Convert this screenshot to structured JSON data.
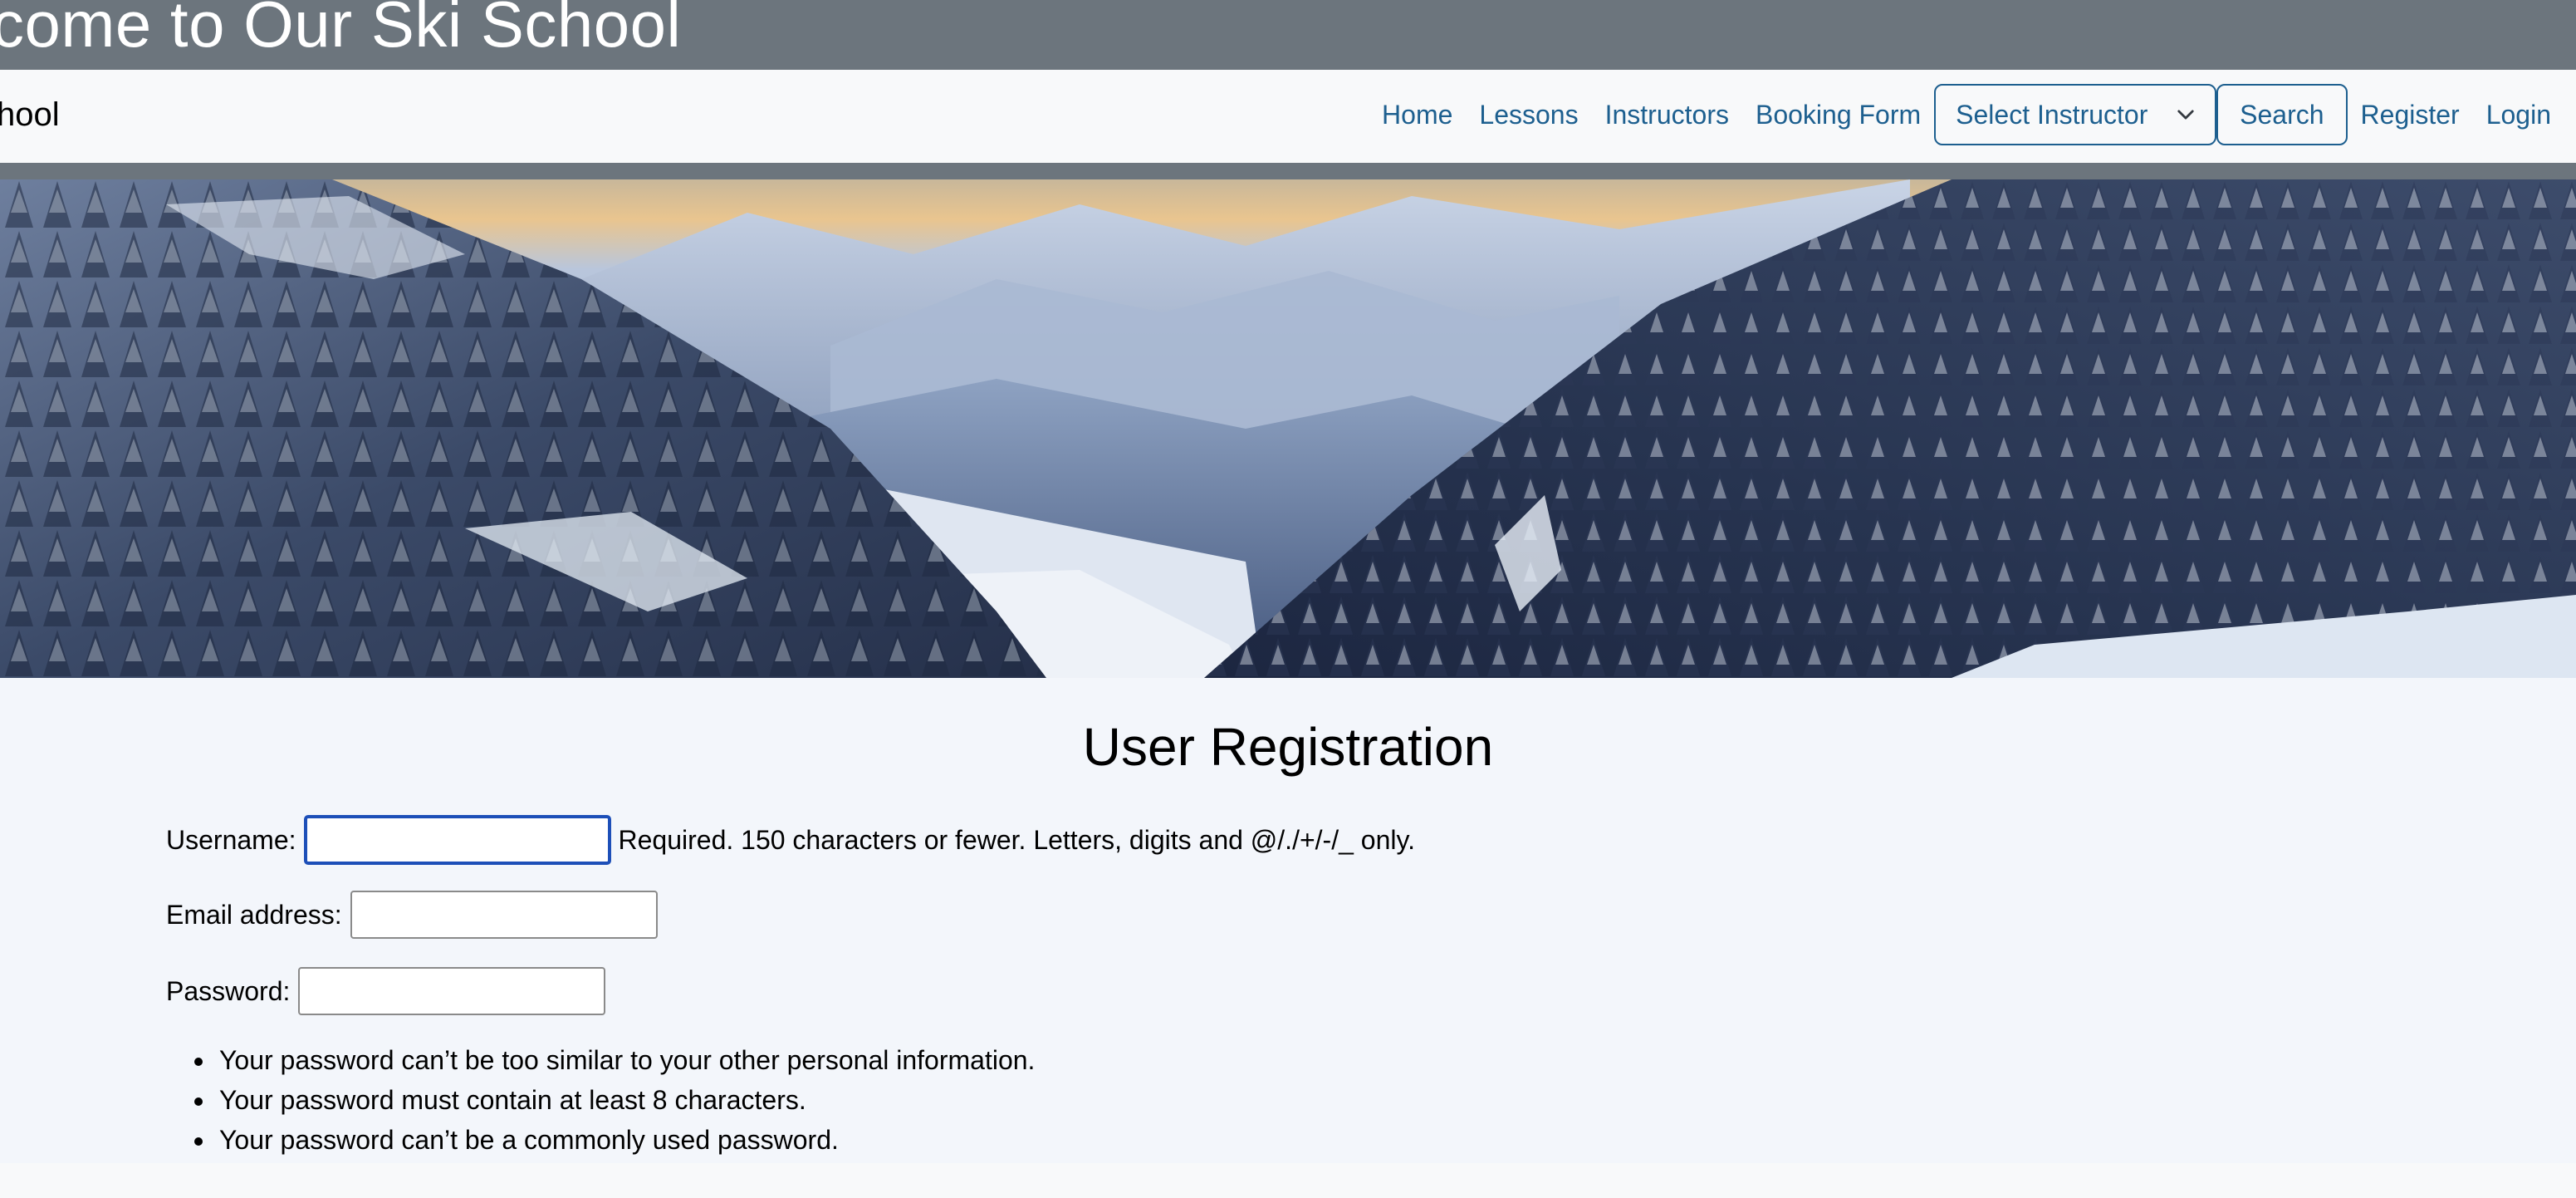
{
  "banner": {
    "title": "come to Our Ski School"
  },
  "navbar": {
    "brand": "hool",
    "links": {
      "home": "Home",
      "lessons": "Lessons",
      "instructors": "Instructors",
      "booking": "Booking Form"
    },
    "instructor_select": "Select Instructor",
    "search": "Search",
    "register": "Register",
    "login": "Login"
  },
  "hero": {
    "image": "snowy-mountain-valley-image"
  },
  "registration": {
    "title": "User Registration",
    "username_label": "Username:",
    "username_value": "",
    "username_help": "Required. 150 characters or fewer. Letters, digits and @/./+/-/_ only.",
    "email_label": "Email address:",
    "email_value": "",
    "password_label": "Password:",
    "password_value": "",
    "password_help": [
      "Your password can’t be too similar to your other personal information.",
      "Your password must contain at least 8 characters.",
      "Your password can’t be a commonly used password."
    ]
  },
  "colors": {
    "banner": "#6c757d",
    "link": "#1d5f8f",
    "focus": "#1d4fb8"
  }
}
